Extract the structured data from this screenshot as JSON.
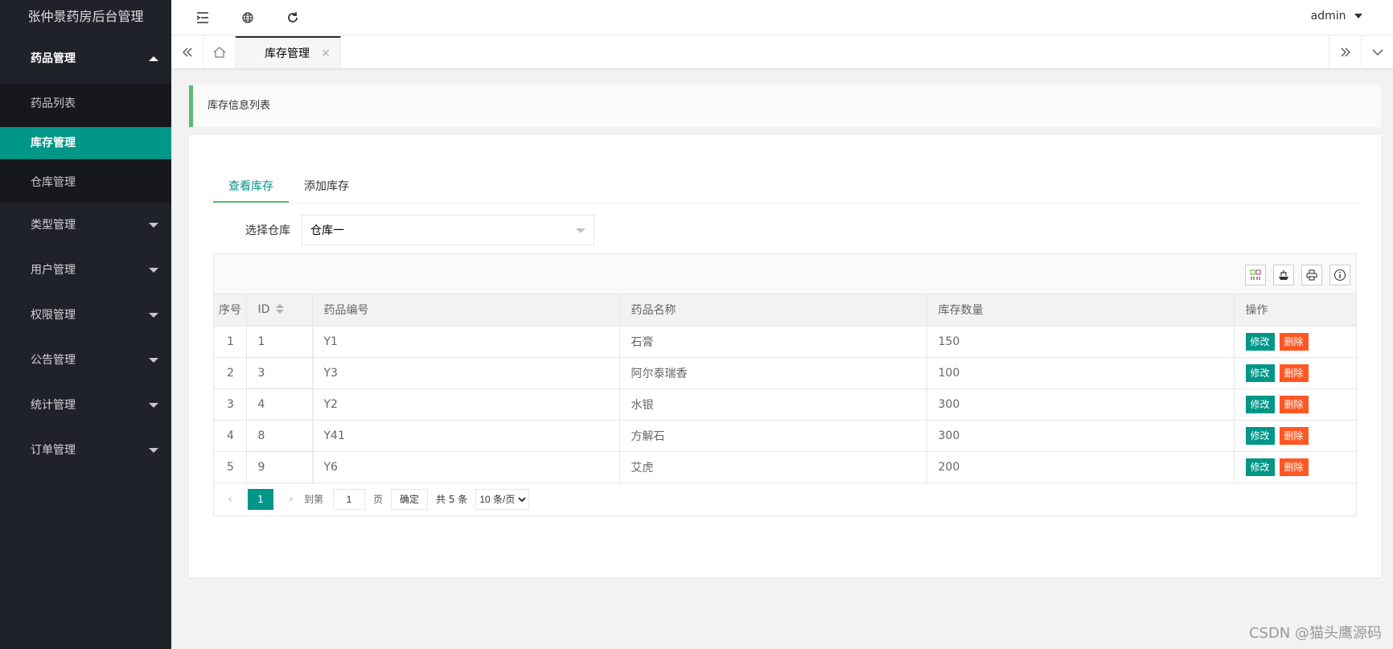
{
  "app": {
    "title": "张仲景药房后台管理"
  },
  "sidebar": {
    "groups": [
      {
        "label": "药品管理",
        "open": true,
        "items": [
          {
            "label": "药品列表",
            "active": false
          },
          {
            "label": "库存管理",
            "active": true
          },
          {
            "label": "仓库管理",
            "active": false
          }
        ]
      },
      {
        "label": "类型管理"
      },
      {
        "label": "用户管理"
      },
      {
        "label": "权限管理"
      },
      {
        "label": "公告管理"
      },
      {
        "label": "统计管理"
      },
      {
        "label": "订单管理"
      }
    ]
  },
  "header": {
    "user": "admin"
  },
  "tabsbar": {
    "current_tab": "库存管理",
    "close_glyph": "×"
  },
  "content": {
    "quote": "库存信息列表",
    "tabs": [
      "查看库存",
      "添加库存"
    ],
    "form": {
      "label": "选择仓库",
      "value": "仓库一"
    },
    "table": {
      "columns": [
        "序号",
        "ID",
        "药品编号",
        "药品名称",
        "库存数量",
        "操作"
      ],
      "rows": [
        [
          "1",
          "1",
          "Y1",
          "石膏",
          "150"
        ],
        [
          "2",
          "3",
          "Y3",
          "阿尔泰瑞香",
          "100"
        ],
        [
          "3",
          "4",
          "Y2",
          "水银",
          "300"
        ],
        [
          "4",
          "8",
          "Y41",
          "方解石",
          "300"
        ],
        [
          "5",
          "9",
          "Y6",
          "艾虎",
          "200"
        ]
      ],
      "edit_label": "修改",
      "delete_label": "删除"
    },
    "pager": {
      "current": "1",
      "goto_label": "到第",
      "goto_value": "1",
      "page_label": "页",
      "confirm_label": "确定",
      "total_label": "共 5 条",
      "size_option": "10 条/页"
    }
  },
  "watermark": "CSDN @猫头鹰源码",
  "colors": {
    "sidebar_bg": "#20222a",
    "accent": "#009688",
    "danger": "#ff5722",
    "quote_border": "#5fb878"
  }
}
